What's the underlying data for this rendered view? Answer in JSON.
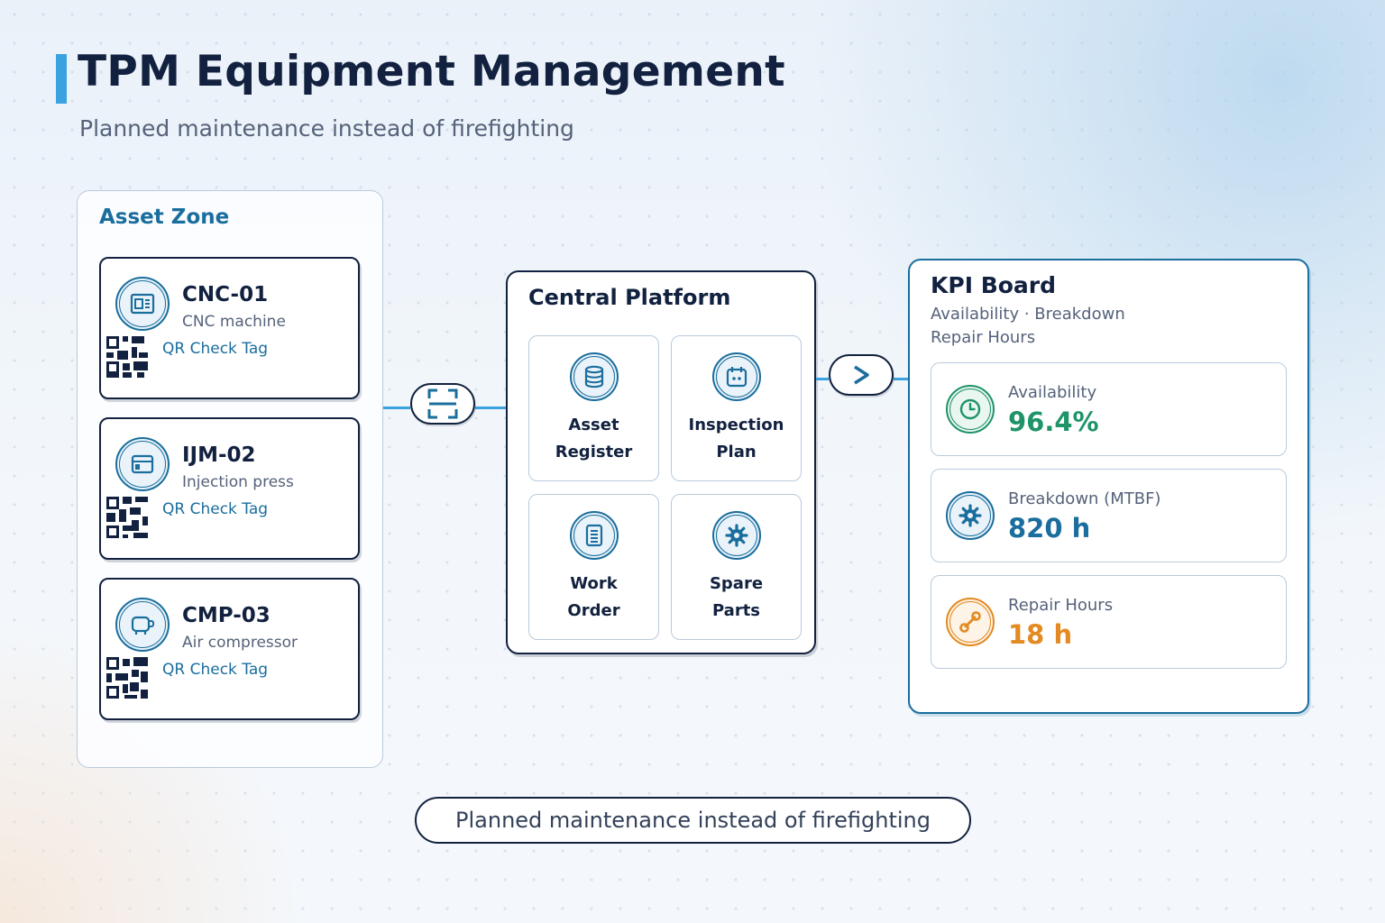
{
  "header": {
    "title": "TPM Equipment Management",
    "subtitle": "Planned maintenance instead of firefighting"
  },
  "asset_zone": {
    "title": "Asset Zone",
    "assets": [
      {
        "id": "CNC-01",
        "description": "CNC machine",
        "tag": "QR Check Tag",
        "icon": "cnc-machine-icon"
      },
      {
        "id": "IJM-02",
        "description": "Injection press",
        "tag": "QR Check Tag",
        "icon": "injection-press-icon"
      },
      {
        "id": "CMP-03",
        "description": "Air compressor",
        "tag": "QR Check Tag",
        "icon": "compressor-icon"
      }
    ]
  },
  "connectors": {
    "scan_icon": "qr-scan-icon",
    "arrow_icon": "chevron-right-icon"
  },
  "platform": {
    "title": "Central Platform",
    "modules": [
      {
        "line1": "Asset",
        "line2": "Register",
        "icon": "database-icon"
      },
      {
        "line1": "Inspection",
        "line2": "Plan",
        "icon": "calendar-icon"
      },
      {
        "line1": "Work",
        "line2": "Order",
        "icon": "document-icon"
      },
      {
        "line1": "Spare",
        "line2": "Parts",
        "icon": "gear-icon"
      }
    ]
  },
  "kpi": {
    "title": "KPI Board",
    "subtitle_line1": "Availability · Breakdown",
    "subtitle_line2": "Repair Hours",
    "cards": [
      {
        "label": "Availability",
        "value": "96.4%",
        "color": "#1e9468",
        "icon": "clock-icon"
      },
      {
        "label": "Breakdown (MTBF)",
        "value": "820 h",
        "color": "#1a6e9d",
        "icon": "gear-icon"
      },
      {
        "label": "Repair Hours",
        "value": "18 h",
        "color": "#e38a22",
        "icon": "wrench-icon"
      }
    ]
  },
  "colors": {
    "navy": "#12213f",
    "accent_blue": "#1a6e9d",
    "connector_blue": "#3aa2de",
    "green": "#1e9468",
    "orange": "#e38a22"
  },
  "footer": {
    "text": "Planned maintenance instead of firefighting"
  }
}
